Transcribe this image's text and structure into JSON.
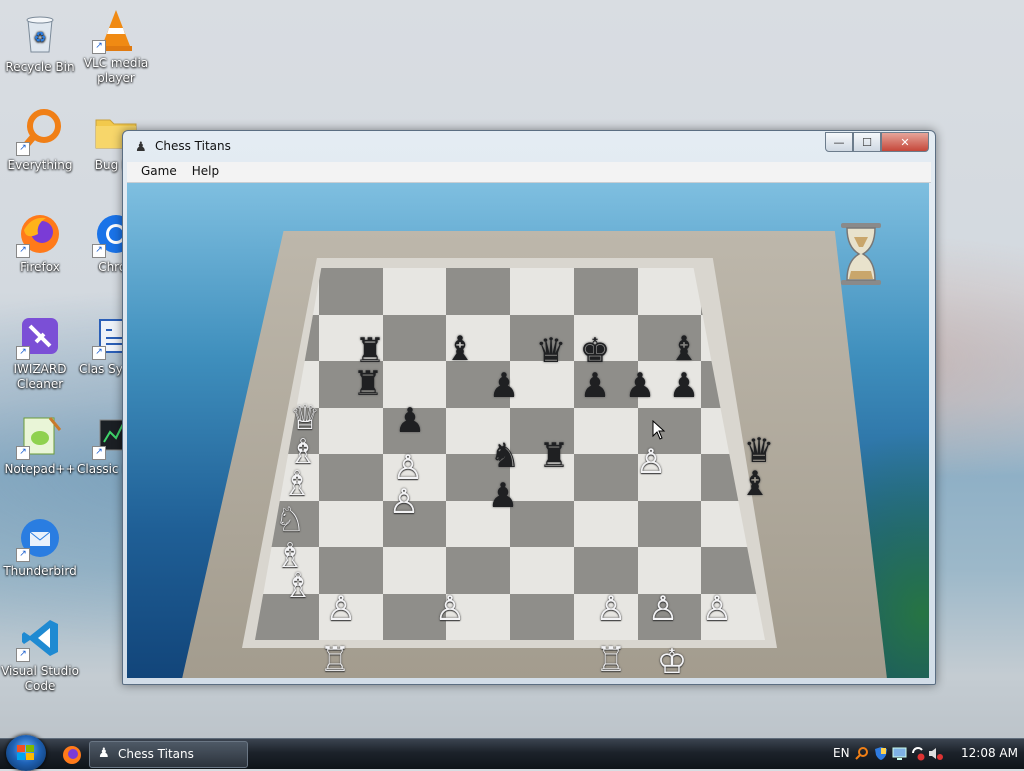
{
  "desktop": {
    "icons": [
      {
        "label": "Recycle Bin"
      },
      {
        "label": "VLC media player"
      },
      {
        "label": "Everything"
      },
      {
        "label": "Bug Re"
      },
      {
        "label": "Firefox"
      },
      {
        "label": "Chron"
      },
      {
        "label": "IWIZARD Cleaner"
      },
      {
        "label": "Clas System"
      },
      {
        "label": "Notepad++"
      },
      {
        "label": "Classic Mana"
      },
      {
        "label": "Thunderbird"
      },
      {
        "label": "Visual Studio Code"
      }
    ]
  },
  "window": {
    "title": "Chess Titans",
    "menu": [
      "Game",
      "Help"
    ],
    "buttons": {
      "minimize": "—",
      "maximize": "☐",
      "close": "✕"
    }
  },
  "board": {
    "black_pieces": [
      "♜",
      "♝",
      "♛",
      "♚",
      "♝",
      "♜",
      "♟",
      "♟",
      "♟",
      "♟",
      "♟",
      "♞",
      "♜",
      "♛",
      "♟",
      "♝"
    ],
    "white_pieces": [
      "♕",
      "♗",
      "♗",
      "♘",
      "♙",
      "♙",
      "♙",
      "♗",
      "♗",
      "♙",
      "♙",
      "♙",
      "♙",
      "♙",
      "♖",
      "♖",
      "♔"
    ]
  },
  "taskbar": {
    "task_label": "Chess Titans",
    "language": "EN",
    "clock": "12:08 AM"
  },
  "colors": {
    "accent": "#1f63b7",
    "board_light": "#e7e6e2",
    "board_dark": "#8f8e8a"
  }
}
